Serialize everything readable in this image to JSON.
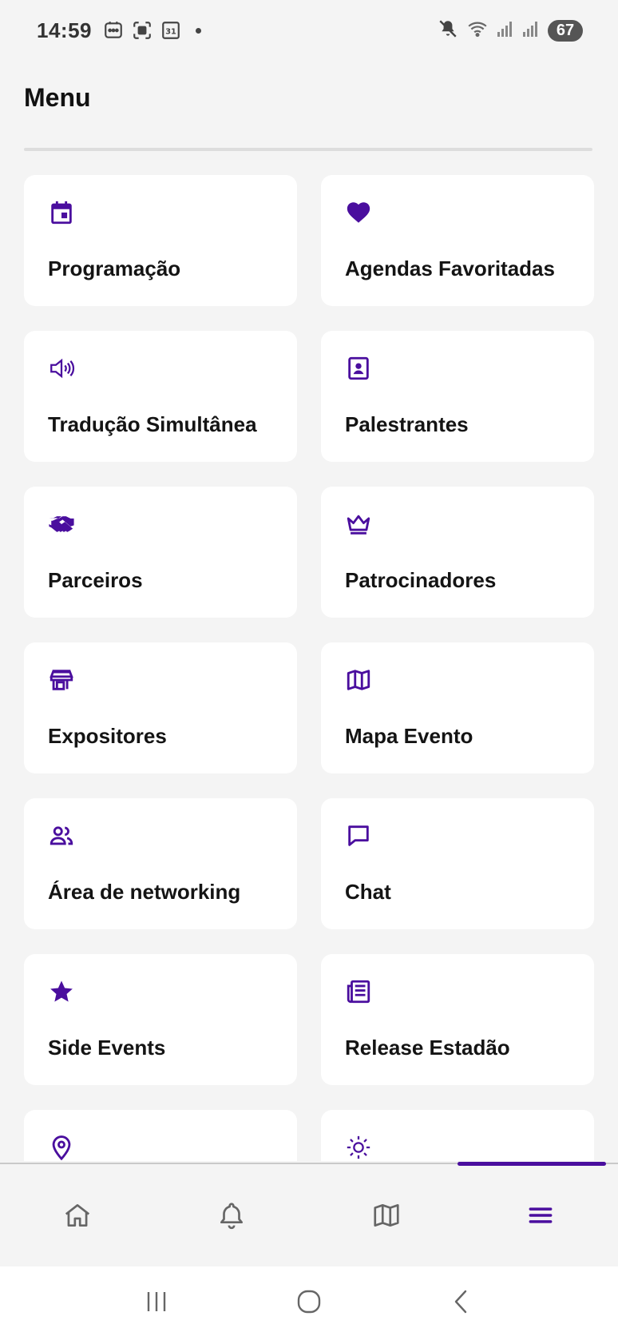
{
  "status_bar": {
    "time": "14:59",
    "battery": "67"
  },
  "header": {
    "title": "Menu"
  },
  "colors": {
    "accent": "#4a0e9e",
    "background": "#f4f4f4",
    "card": "#ffffff"
  },
  "menu": {
    "items": [
      {
        "label": "Programação",
        "icon": "calendar-icon"
      },
      {
        "label": "Agendas Favoritadas",
        "icon": "heart-icon"
      },
      {
        "label": "Tradução Simultânea",
        "icon": "speaker-icon"
      },
      {
        "label": "Palestrantes",
        "icon": "contact-card-icon"
      },
      {
        "label": "Parceiros",
        "icon": "handshake-icon"
      },
      {
        "label": "Patrocinadores",
        "icon": "crown-icon"
      },
      {
        "label": "Expositores",
        "icon": "storefront-icon"
      },
      {
        "label": "Mapa Evento",
        "icon": "map-icon"
      },
      {
        "label": "Área de networking",
        "icon": "people-icon"
      },
      {
        "label": "Chat",
        "icon": "chat-bubble-icon"
      },
      {
        "label": "Side Events",
        "icon": "star-icon"
      },
      {
        "label": "Release Estadão",
        "icon": "newspaper-icon"
      },
      {
        "label": "",
        "icon": "location-pin-icon"
      },
      {
        "label": "",
        "icon": "sun-icon"
      }
    ]
  },
  "bottom_nav": {
    "items": [
      {
        "icon": "home-icon",
        "active": false
      },
      {
        "icon": "bell-icon",
        "active": false
      },
      {
        "icon": "map-icon",
        "active": false
      },
      {
        "icon": "hamburger-menu-icon",
        "active": true
      }
    ]
  },
  "system_nav": {
    "items": [
      "recent-apps-icon",
      "home-circle-icon",
      "back-chevron-icon"
    ]
  }
}
